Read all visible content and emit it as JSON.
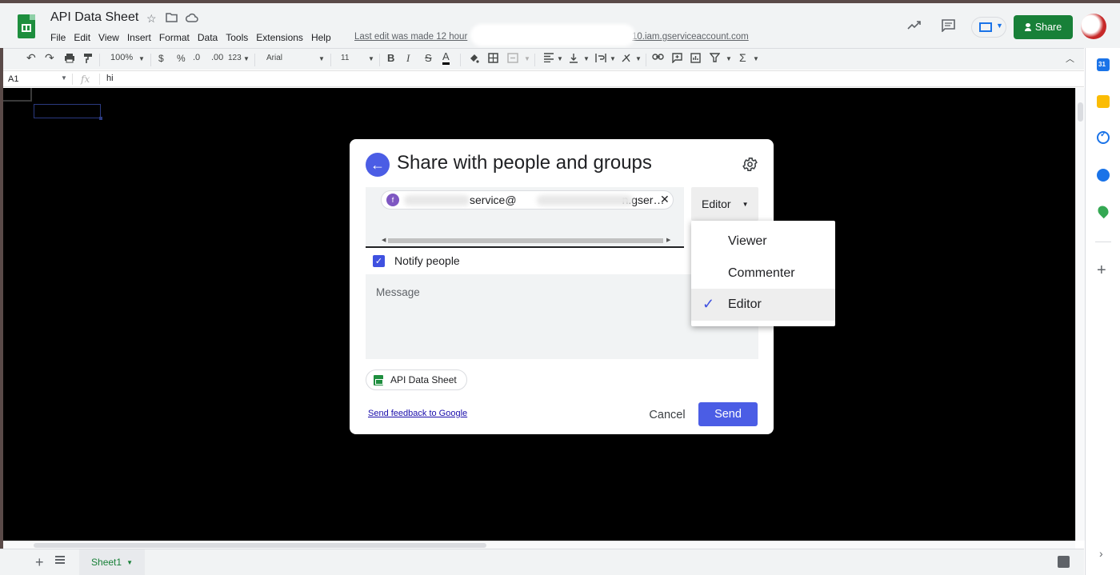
{
  "header": {
    "doc_title": "API Data Sheet",
    "menu": [
      "File",
      "Edit",
      "View",
      "Insert",
      "Format",
      "Data",
      "Tools",
      "Extensions",
      "Help"
    ],
    "last_edit_prefix": "Last edit was made 12 hour",
    "last_edit_suffix": "10.iam.gserviceaccount.com",
    "share_label": "Share"
  },
  "toolbar": {
    "zoom": "100%",
    "currency": "$",
    "percent": "%",
    "decrease_decimal": ".0",
    "increase_decimal": ".00",
    "more_formats": "123",
    "font": "Arial",
    "font_size": "11",
    "bold": "B",
    "italic": "I",
    "strike": "S",
    "text_color": "A",
    "functions": "Σ"
  },
  "formula_bar": {
    "cell_ref": "A1",
    "fx": "fx",
    "value": "hi"
  },
  "sheet_tabs": {
    "active": "Sheet1"
  },
  "dialog": {
    "title": "Share with people and groups",
    "chip_avatar_letter": "f",
    "chip_text": "service@",
    "chip_text_tail": "n.gser…",
    "role_button": "Editor",
    "notify_label": "Notify people",
    "notify_checked": true,
    "message_placeholder": "Message",
    "file_chip": "API Data Sheet",
    "feedback_link": "Send feedback to Google",
    "cancel_label": "Cancel",
    "send_label": "Send"
  },
  "role_menu": {
    "options": [
      {
        "label": "Viewer",
        "selected": false
      },
      {
        "label": "Commenter",
        "selected": false
      },
      {
        "label": "Editor",
        "selected": true
      }
    ]
  },
  "colors": {
    "accent_blue": "#4b5de5",
    "share_green": "#188038",
    "overlay": "#000000"
  },
  "icons": [
    "undo-icon",
    "redo-icon",
    "print-icon",
    "paint-format-icon",
    "star-icon",
    "folder-icon",
    "cloud-icon",
    "trending-icon",
    "comment-icon",
    "present-icon",
    "settings-icon",
    "back-arrow-icon",
    "check-icon",
    "close-icon"
  ]
}
